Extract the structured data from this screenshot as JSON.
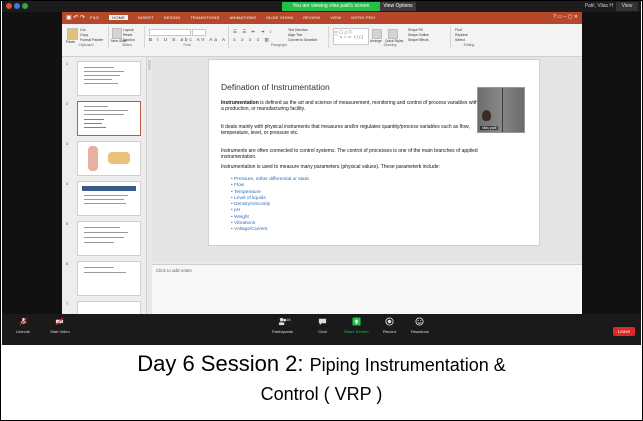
{
  "zoom": {
    "banner": "You are viewing vilas patil's screen",
    "view_options": "View Options",
    "user": "Patil, Vilas H",
    "view": "View",
    "toolbar": {
      "unmute": "Unmute",
      "start_video": "Start Video",
      "participants": "Participants",
      "participants_count": "18",
      "chat": "Chat",
      "share_screen": "Share Screen",
      "record": "Record",
      "reactions": "Reactions",
      "leave": "Leave"
    }
  },
  "ppt": {
    "tabs": [
      "FILE",
      "HOME",
      "INSERT",
      "DESIGN",
      "TRANSITIONS",
      "ANIMATIONS",
      "SLIDE SHOW",
      "REVIEW",
      "VIEW",
      "NITRO PRO"
    ],
    "ribbon": {
      "cut": "Cut",
      "copy": "Copy",
      "format_painter": "Format Painter",
      "paste": "Paste",
      "new_slide": "New Slide",
      "layout": "Layout",
      "reset": "Reset",
      "section": "Section",
      "text_direction": "Text Direction",
      "align_text": "Align Text",
      "convert_smartart": "Convert to SmartArt",
      "arrange": "Arrange",
      "quick_styles": "Quick Styles",
      "shape_fill": "Shape Fill",
      "shape_outline": "Shape Outline",
      "shape_effects": "Shape Effects",
      "find": "Find",
      "replace": "Replace",
      "select": "Select",
      "groups": [
        "Clipboard",
        "Slides",
        "Font",
        "Paragraph",
        "Drawing",
        "Editing"
      ]
    },
    "slide_numbers": [
      "1",
      "2",
      "3",
      "4",
      "5",
      "6",
      "7"
    ],
    "slide": {
      "title": "Defination of Instrumentation",
      "para1_bold": "Instrumentation",
      "para1_rest": " is defined as the art and science of measurement, monitoring and control of process variables within a production, or manufacturing facility.",
      "para2": "It deals mainly with physical instruments that measures and/or regulates quantity/process variables such as flow, temperature, level, or pressure etc.",
      "para3": "Instruments are often connected to control systems. The control of processes is one of the main branches of applied instrumentation.",
      "para4": "Instrumentation is used to measure many parameters (physical values). These parameters include:",
      "bullets": [
        "Pressure, either differential or static",
        "Flow",
        "Temperature",
        "Level of liquids",
        "Density/Viscosity",
        "pH",
        "Weight",
        "Vibrations",
        "Voltage/Current"
      ]
    },
    "webcam_name": "vilas patil",
    "notes_placeholder": "Click to add notes"
  },
  "caption": {
    "line1_a": "Day 6 Session 2:  ",
    "line1_b": "Piping Instrumentation &",
    "line2": "Control ( VRP )"
  },
  "colors": {
    "ppt_accent": "#b7472a",
    "zoom_green": "#24c14a",
    "leave_red": "#e02828",
    "bullet_blue": "#2e6ec0"
  }
}
